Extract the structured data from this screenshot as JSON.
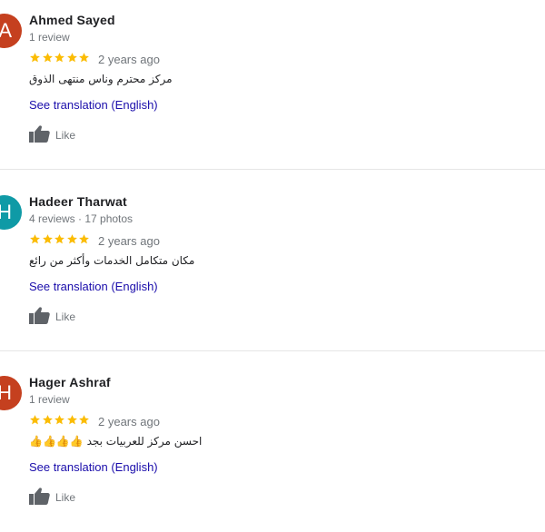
{
  "colors": {
    "star": "#fbbc04",
    "link": "#1a0dab",
    "avatar_a": "#c5401f",
    "avatar_h_teal": "#0f9aa6",
    "avatar_h_red": "#c5401f"
  },
  "icons": {
    "star": "star-icon",
    "like": "thumbs-up-icon"
  },
  "reviews": [
    {
      "initial": "A",
      "name": "Ahmed Sayed",
      "meta": "1 review",
      "rating": 5,
      "age": "2 years ago",
      "text": "مركز محترم وناس منتهى الذوق",
      "translate_label": "See translation (English)",
      "like_label": "Like"
    },
    {
      "initial": "H",
      "name": "Hadeer Tharwat",
      "meta": "4 reviews · 17 photos",
      "rating": 5,
      "age": "2 years ago",
      "text": "مكان متكامل الخدمات وأكثر من رائع",
      "translate_label": "See translation (English)",
      "like_label": "Like"
    },
    {
      "initial": "H",
      "name": "Hager Ashraf",
      "meta": "1 review",
      "rating": 5,
      "age": "2 years ago",
      "text": "احسن مركز للعربيات بجد 👍👍👍👍",
      "translate_label": "See translation (English)",
      "like_label": "Like"
    }
  ]
}
